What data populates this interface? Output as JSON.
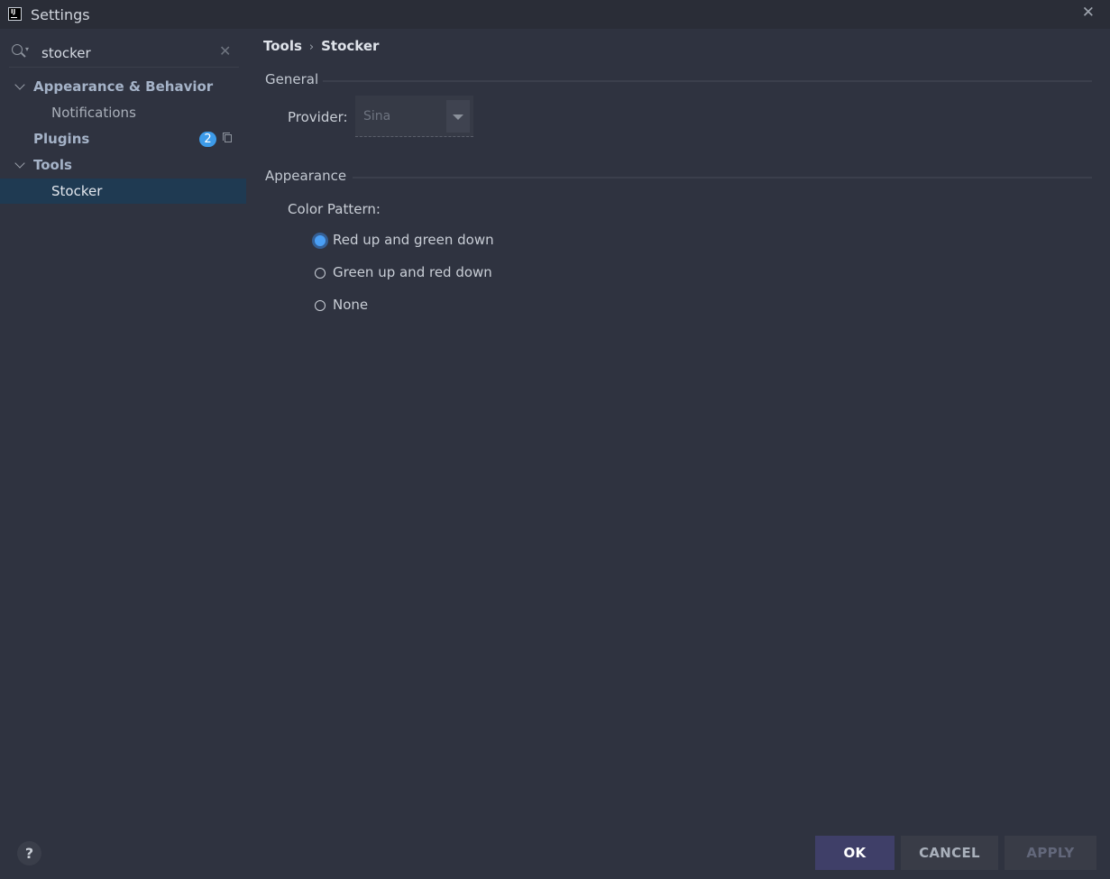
{
  "window": {
    "title": "Settings",
    "app_icon_text": "IJ",
    "close_glyph": "✕"
  },
  "sidebar": {
    "search": {
      "value": "stocker",
      "clear_glyph": "✕"
    },
    "items": [
      {
        "label": "Appearance & Behavior",
        "expanded": true,
        "level": 0
      },
      {
        "label": "Notifications",
        "level": 1
      },
      {
        "label": "Plugins",
        "level": 0,
        "badge": "2"
      },
      {
        "label": "Tools",
        "expanded": true,
        "level": 0
      },
      {
        "label": "Stocker",
        "level": 1,
        "selected": true
      }
    ]
  },
  "main": {
    "breadcrumb": {
      "parent": "Tools",
      "separator": "›",
      "current": "Stocker"
    },
    "general": {
      "title": "General",
      "provider_label": "Provider:",
      "provider_value": "Sina"
    },
    "appearance": {
      "title": "Appearance",
      "color_pattern_label": "Color Pattern:",
      "options": [
        {
          "label": "Red up and green down",
          "checked": true
        },
        {
          "label": "Green up and red down",
          "checked": false
        },
        {
          "label": "None",
          "checked": false
        }
      ]
    }
  },
  "footer": {
    "help": "?",
    "ok": "OK",
    "cancel": "CANCEL",
    "apply": "APPLY"
  },
  "colors": {
    "background": "#2f3340",
    "selection": "#1f3a52",
    "accent": "#4a9ff5",
    "ok_button": "#3f3f68"
  }
}
